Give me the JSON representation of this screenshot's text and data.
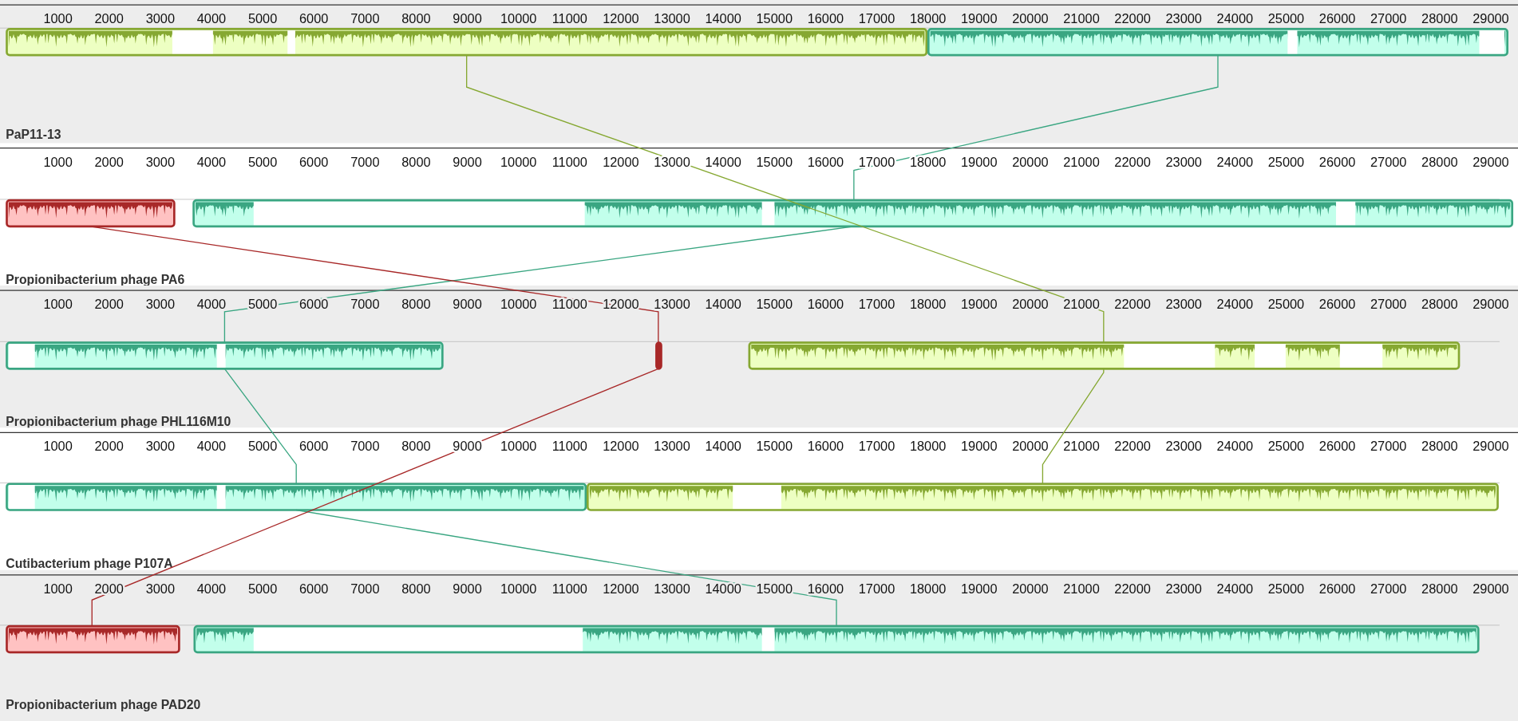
{
  "genomes": [
    {
      "name": "PaP11-13",
      "ticks": [
        "1000",
        "2000",
        "3000",
        "4000",
        "5000",
        "6000",
        "7000",
        "8000",
        "9000",
        "10000",
        "11000",
        "12000",
        "13000",
        "14000",
        "15000",
        "16000",
        "17000",
        "18000",
        "19000",
        "20000",
        "21000",
        "22000",
        "23000",
        "24000",
        "25000",
        "26000",
        "27000",
        "28000",
        "29000"
      ],
      "blocks": [
        {
          "color": "#86a832"
        },
        {
          "color": "#3aa682"
        }
      ]
    },
    {
      "name": "Propionibacterium phage PA6",
      "ticks": [
        "1000",
        "2000",
        "3000",
        "4000",
        "5000",
        "6000",
        "7000",
        "8000",
        "9000",
        "10000",
        "11000",
        "12000",
        "13000",
        "14000",
        "15000",
        "16000",
        "17000",
        "18000",
        "19000",
        "20000",
        "21000",
        "22000",
        "23000",
        "24000",
        "25000",
        "26000",
        "27000",
        "28000",
        "29000"
      ],
      "blocks": [
        {
          "color": "#a82828"
        },
        {
          "color": "#3aa682"
        }
      ]
    },
    {
      "name": "Propionibacterium phage PHL116M10",
      "ticks": [
        "1000",
        "2000",
        "3000",
        "4000",
        "5000",
        "6000",
        "7000",
        "8000",
        "9000",
        "10000",
        "11000",
        "12000",
        "13000",
        "14000",
        "15000",
        "16000",
        "17000",
        "18000",
        "19000",
        "20000",
        "21000",
        "22000",
        "23000",
        "24000",
        "25000",
        "26000",
        "27000",
        "28000",
        "29000"
      ],
      "blocks": [
        {
          "color": "#3aa682"
        },
        {
          "color": "#a82828"
        },
        {
          "color": "#86a832"
        }
      ]
    },
    {
      "name": "Cutibacterium phage P107A",
      "ticks": [
        "1000",
        "2000",
        "3000",
        "4000",
        "5000",
        "6000",
        "7000",
        "8000",
        "9000",
        "10000",
        "11000",
        "12000",
        "13000",
        "14000",
        "15000",
        "16000",
        "17000",
        "18000",
        "19000",
        "20000",
        "21000",
        "22000",
        "23000",
        "24000",
        "25000",
        "26000",
        "27000",
        "28000",
        "29000"
      ],
      "blocks": [
        {
          "color": "#3aa682"
        },
        {
          "color": "#86a832"
        }
      ]
    },
    {
      "name": "Propionibacterium phage PAD20",
      "ticks": [
        "1000",
        "2000",
        "3000",
        "4000",
        "5000",
        "6000",
        "7000",
        "8000",
        "9000",
        "10000",
        "11000",
        "12000",
        "13000",
        "14000",
        "15000",
        "16000",
        "17000",
        "18000",
        "19000",
        "20000",
        "21000",
        "22000",
        "23000",
        "24000",
        "25000",
        "26000",
        "27000",
        "28000",
        "29000"
      ],
      "blocks": [
        {
          "color": "#a82828"
        },
        {
          "color": "#3aa682"
        }
      ]
    }
  ]
}
